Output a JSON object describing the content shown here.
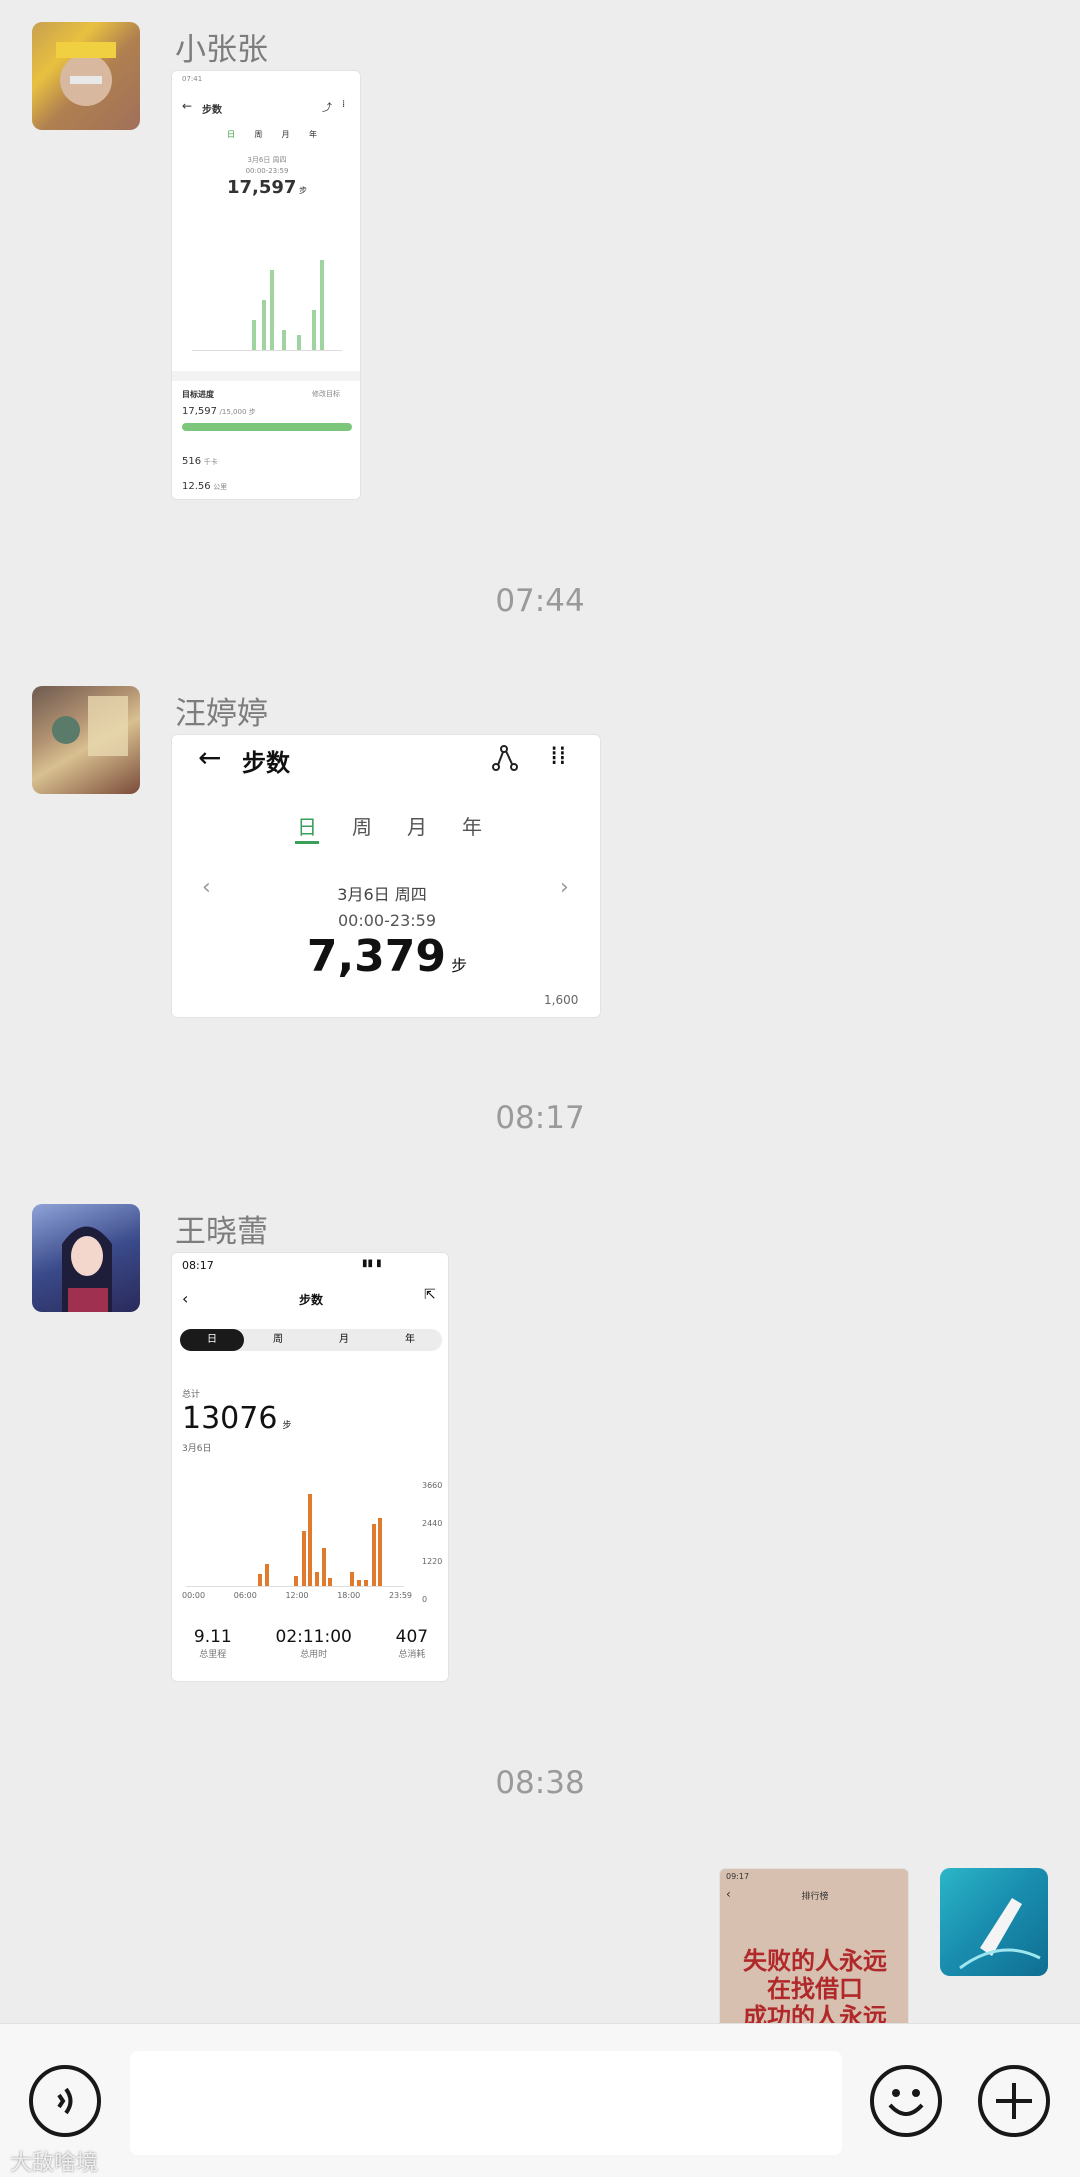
{
  "messages": [
    {
      "sender": "小张张",
      "shot": {
        "status_time": "07:41",
        "title": "步数",
        "tabs": [
          "日",
          "周",
          "月",
          "年"
        ],
        "date": "3月6日 周四",
        "range": "00:00-23:59",
        "steps": "17,597",
        "unit": "步",
        "goal_label": "目标进度",
        "goal_edit": "修改目标",
        "goal_value": "17,597",
        "goal_target": "/15,000 步",
        "goal_progress": 1.0,
        "calories": "516",
        "calories_unit": "千卡",
        "distance": "12.56",
        "distance_unit": "公里"
      }
    },
    {
      "time": "07:44",
      "sender": "汪婷婷",
      "shot": {
        "title": "步数",
        "tabs": [
          "日",
          "周",
          "月",
          "年"
        ],
        "date": "3月6日 周四",
        "range": "00:00-23:59",
        "steps": "7,379",
        "unit": "步",
        "axis_max": "1,600"
      }
    },
    {
      "time": "08:17",
      "sender": "王晓蕾",
      "shot": {
        "status_time": "08:17",
        "title": "步数",
        "tabs": [
          "日",
          "周",
          "月",
          "年"
        ],
        "total_label": "总计",
        "steps": "13076",
        "unit": "步",
        "date": "3月6日",
        "y_ticks": [
          "3660",
          "2440",
          "1220",
          "0"
        ],
        "x_ticks": [
          "00:00",
          "06:00",
          "12:00",
          "18:00",
          "23:59"
        ],
        "stats": [
          {
            "value": "9.11",
            "label": "总里程"
          },
          {
            "value": "02:11:00",
            "label": "总用时"
          },
          {
            "value": "407",
            "label": "总消耗"
          }
        ]
      }
    },
    {
      "time": "08:38",
      "outgoing": true,
      "shot": {
        "status_time": "09:17",
        "header": "排行榜",
        "headline_1": "失败的人永远",
        "headline_2": "在找借口",
        "headline_3": "成功的人永远"
      }
    }
  ],
  "input": {
    "placeholder": ""
  },
  "watermark": "大敌啥境"
}
